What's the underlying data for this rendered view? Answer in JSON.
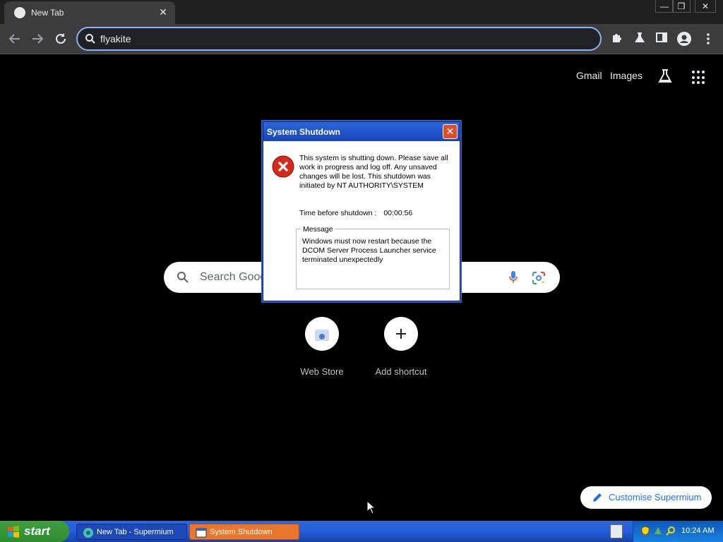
{
  "browser": {
    "tab_title": "New Tab",
    "tab_close": "✕",
    "address_value": "flyakite",
    "window_controls": [
      "—",
      "❐",
      "✕"
    ]
  },
  "ntp": {
    "gmail": "Gmail",
    "images": "Images",
    "search_placeholder": "Search Goog",
    "shortcuts": [
      {
        "label": "Web Store"
      },
      {
        "label": "Add shortcut"
      }
    ],
    "customise": "Customise Supermium"
  },
  "dialog": {
    "title": "System Shutdown",
    "close": "✕",
    "text": "This system is shutting down. Please save all work in progress and log off. Any unsaved changes will be lost. This shutdown was initiated by NT AUTHORITY\\SYSTEM",
    "time_label": "Time before shutdown :",
    "time_value": "00:00:56",
    "message_legend": "Message",
    "message": "Windows must now restart because the DCOM Server Process Launcher service terminated unexpectedly"
  },
  "taskbar": {
    "start": "start",
    "tasks": [
      {
        "label": "New Tab - Supermium",
        "icon": "supermium-icon"
      },
      {
        "label": "System Shutdown",
        "icon": "window-icon"
      }
    ],
    "clock": "10:24 AM"
  },
  "colors": {
    "omnibox_border": "#8ab4f8",
    "xp_blue": "#245edb",
    "start_green": "#3f9e3f",
    "active_task": "#e8762c"
  }
}
